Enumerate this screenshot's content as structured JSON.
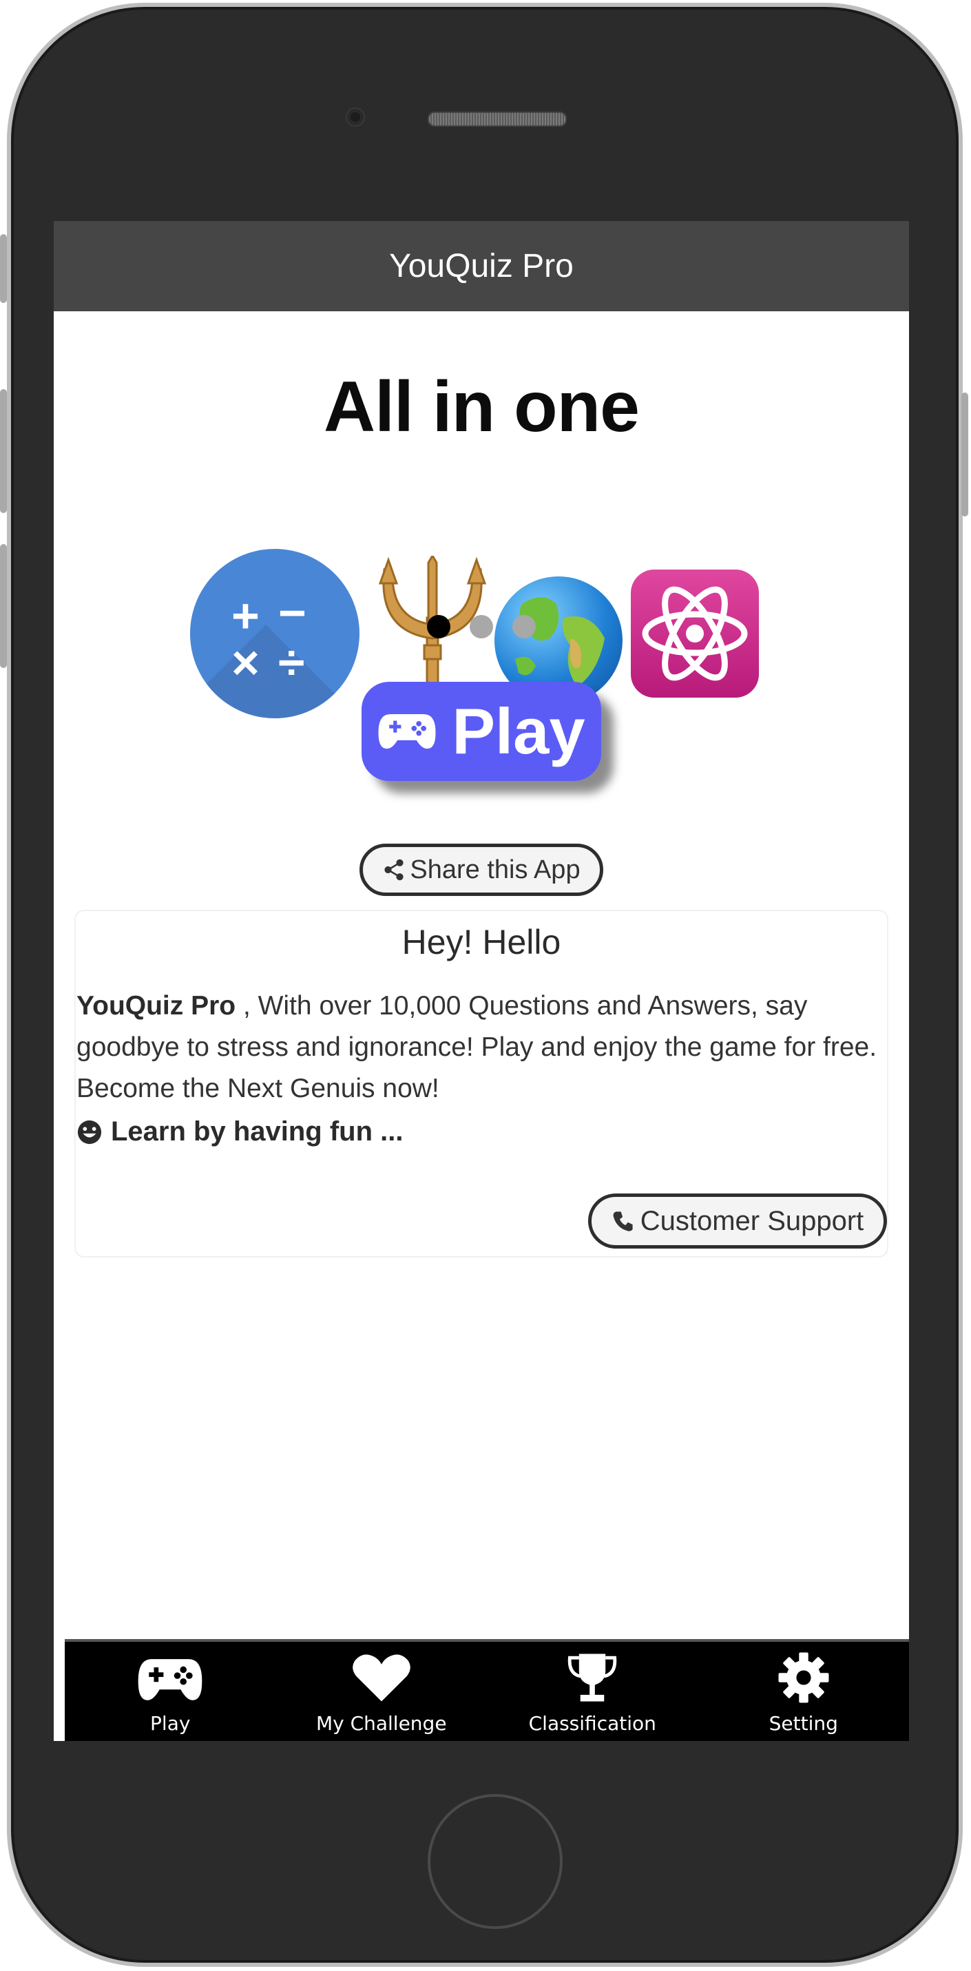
{
  "app": {
    "title": "YouQuiz Pro"
  },
  "banner": {
    "heading": "All in one",
    "icons": [
      "math-operations-icon",
      "trident-icon",
      "globe-icon",
      "atom-icon"
    ],
    "slide_count": 3,
    "active_slide": 1
  },
  "actions": {
    "play_label": "Play",
    "share_label": "Share this App",
    "support_label": "Customer Support"
  },
  "intro": {
    "greeting": "Hey! Hello",
    "brand": "YouQuiz Pro",
    "description": " , With over 10,000 Questions and Answers, say goodbye to stress and ignorance! Play and enjoy the game for free. Become the Next Genuis now!",
    "tagline": "Learn by having fun ..."
  },
  "tabbar": {
    "items": [
      {
        "label": "Play",
        "icon": "gamepad-icon"
      },
      {
        "label": "My Challenge",
        "icon": "heart-icon"
      },
      {
        "label": "Classification",
        "icon": "trophy-icon"
      },
      {
        "label": "Setting",
        "icon": "gear-icon"
      }
    ]
  },
  "colors": {
    "titlebar": "#464646",
    "play_button": "#5b5cf6",
    "tabbar": "#000000"
  }
}
